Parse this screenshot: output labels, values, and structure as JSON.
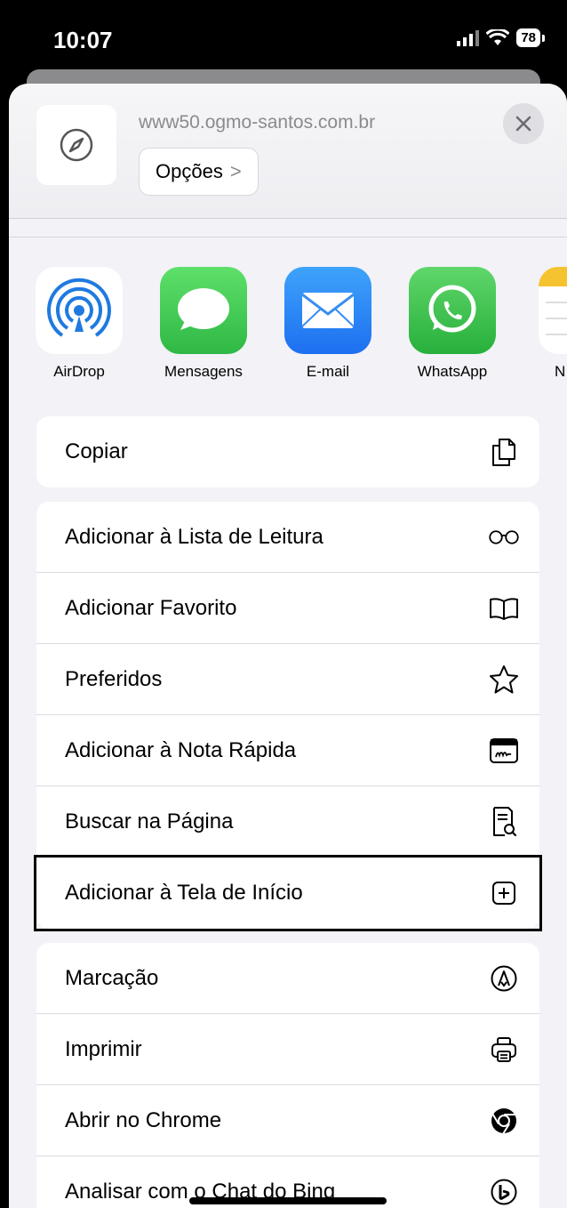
{
  "status_bar": {
    "time": "10:07",
    "battery": "78"
  },
  "header": {
    "url": "www50.ogmo-santos.com.br",
    "options_label": "Opções"
  },
  "apps": [
    {
      "label": "AirDrop",
      "icon": "airdrop-icon"
    },
    {
      "label": "Mensagens",
      "icon": "messages-icon"
    },
    {
      "label": "E-mail",
      "icon": "mail-icon"
    },
    {
      "label": "WhatsApp",
      "icon": "whatsapp-icon"
    },
    {
      "label": "N",
      "icon": "notes-icon"
    }
  ],
  "group1": [
    {
      "label": "Copiar",
      "icon": "copy-icon"
    }
  ],
  "group2": [
    {
      "label": "Adicionar à Lista de Leitura",
      "icon": "glasses-icon"
    },
    {
      "label": "Adicionar Favorito",
      "icon": "book-icon"
    },
    {
      "label": "Preferidos",
      "icon": "star-icon"
    },
    {
      "label": "Adicionar à Nota Rápida",
      "icon": "quick-note-icon"
    },
    {
      "label": "Buscar na Página",
      "icon": "find-in-page-icon"
    },
    {
      "label": "Adicionar à Tela de Início",
      "icon": "add-square-icon"
    }
  ],
  "group3": [
    {
      "label": "Marcação",
      "icon": "markup-icon"
    },
    {
      "label": "Imprimir",
      "icon": "printer-icon"
    },
    {
      "label": "Abrir no Chrome",
      "icon": "chrome-icon"
    },
    {
      "label": "Analisar com o Chat do Bing",
      "icon": "bing-icon"
    }
  ],
  "colors": {
    "sheet_bg": "#f2f2f7",
    "messages_green": "#34c759",
    "mail_blue": "#2f8ef5",
    "whatsapp_green": "#2ecc40",
    "airdrop_blue": "#1f7ae0"
  }
}
